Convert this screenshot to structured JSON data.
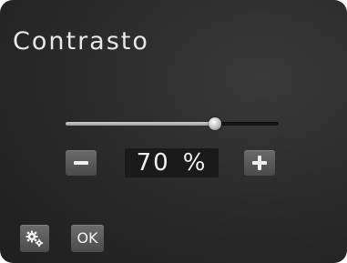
{
  "screen": {
    "title": "Contrasto"
  },
  "contrast": {
    "level": 0.7,
    "value": "70",
    "unit": "%"
  },
  "controls": {
    "decrease_icon": "minus-icon",
    "increase_icon": "plus-icon",
    "settings_icon": "gears-icon",
    "ok_label": "OK"
  }
}
